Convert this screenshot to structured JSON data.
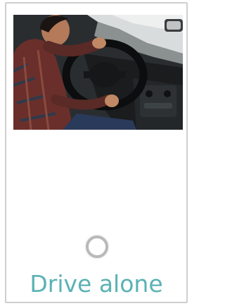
{
  "option": {
    "label": "Drive alone",
    "selected": false,
    "image_subject": "person-driving-car-photo",
    "accent_color": "#5bb2b3"
  }
}
